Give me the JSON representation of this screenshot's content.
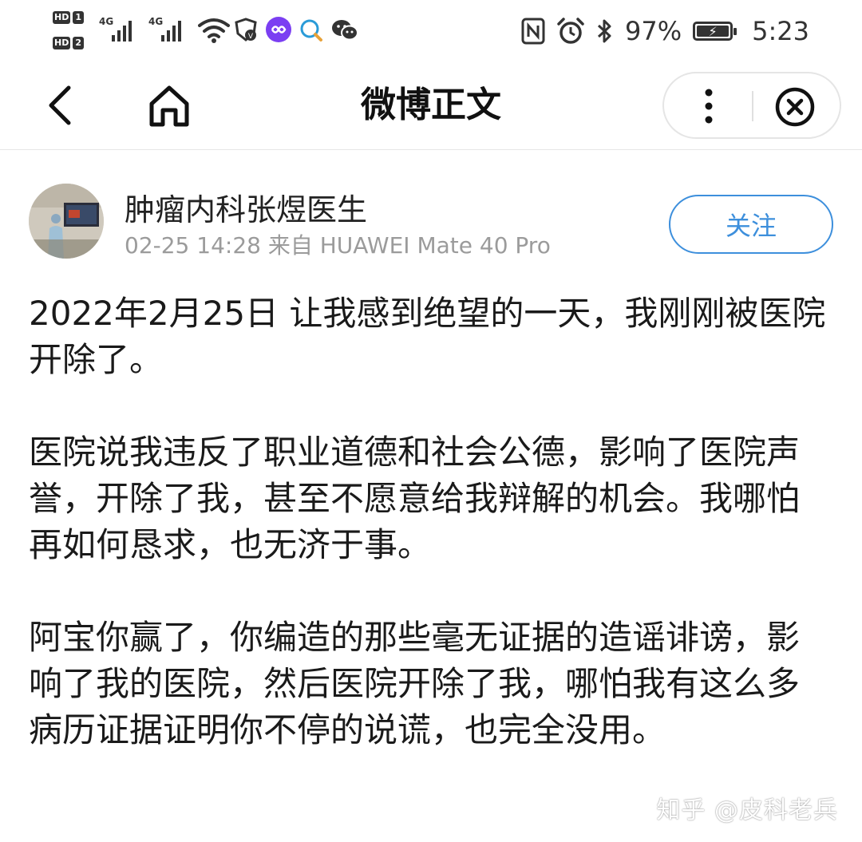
{
  "status_bar": {
    "sim1_label": "HD",
    "sim1_num": "1",
    "sim2_label": "HD",
    "sim2_num": "2",
    "network1": "4G",
    "network2": "4G",
    "battery_percent": "97%",
    "time": "5:23",
    "icons": [
      "wifi-icon",
      "vpn-shield-icon",
      "soul-app-icon",
      "search-chat-icon",
      "wechat-icon",
      "nfc-icon",
      "alarm-icon",
      "bluetooth-icon",
      "battery-charging-icon"
    ]
  },
  "nav": {
    "title": "微博正文",
    "icons": [
      "back-arrow-icon",
      "home-icon",
      "more-vertical-icon",
      "close-circle-icon"
    ]
  },
  "author": {
    "name": "肿瘤内科张煜医生",
    "meta": "02-25 14:28 来自 HUAWEI Mate 40 Pro",
    "follow_label": "关注"
  },
  "post": {
    "paragraphs": [
      "2022年2月25日 让我感到绝望的一天，我刚刚被医院开除了。",
      "医院说我违反了职业道德和社会公德，影响了医院声誉，开除了我，甚至不愿意给我辩解的机会。我哪怕再如何恳求，也无济于事。",
      "阿宝你赢了，你编造的那些毫无证据的造谣诽谤，影响了我的医院，然后医院开除了我，哪怕我有这么多病历证据证明你不停的说谎，也完全没用。"
    ]
  },
  "watermark": "知乎 @皮科老兵",
  "colors": {
    "accent": "#3d8fdc",
    "meta_text": "#9b9b9b",
    "body_text": "#1a1a1a"
  }
}
